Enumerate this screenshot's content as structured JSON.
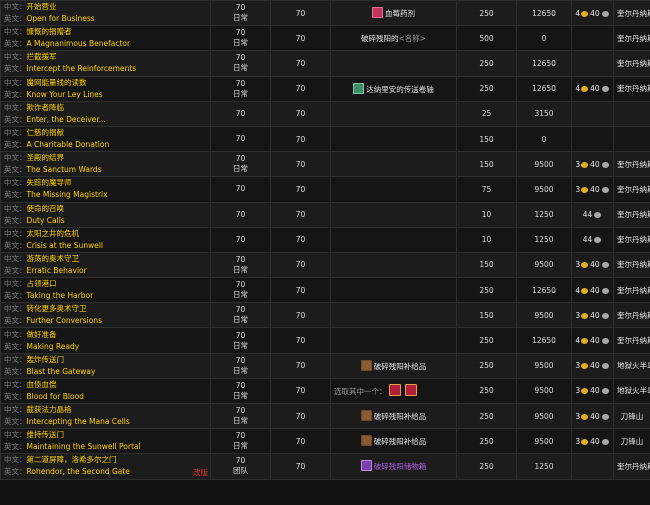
{
  "labels": {
    "zh": "中文：",
    "en": "英文："
  },
  "rows": [
    {
      "zh": "开始营业",
      "en": "Open for Business",
      "lvl": "70",
      "type": "日常",
      "req": "70",
      "reward": {
        "icon": "potion-icon",
        "tone": "red",
        "text": "血莓药剂"
      },
      "rep": "250",
      "xp": "12650",
      "gold": "4",
      "silver": "40",
      "zone": "奎尔丹纳斯岛"
    },
    {
      "zh": "慷慨的捐赠者",
      "en": "A Magnanimous Benefactor",
      "lvl": "70",
      "type": "日常",
      "req": "70",
      "reward": {
        "text": "破碎残阳的",
        "note": "<名称>"
      },
      "rep": "500",
      "xp": "0",
      "gold": "",
      "silver": "",
      "zone": "奎尔丹纳斯岛"
    },
    {
      "zh": "拦截援军",
      "en": "Intercept the Reinforcements",
      "lvl": "70",
      "type": "日常",
      "req": "70",
      "reward": {},
      "rep": "250",
      "xp": "12650",
      "gold": "",
      "silver": "",
      "zone": "奎尔丹纳斯岛"
    },
    {
      "zh": "魔网能量线的读数",
      "en": "Know Your Ley Lines",
      "lvl": "70",
      "type": "日常",
      "req": "70",
      "reward": {
        "icon": "scroll-icon",
        "tone": "teal",
        "text": "达纳里安的传送卷轴"
      },
      "rep": "250",
      "xp": "12650",
      "gold": "4",
      "silver": "40",
      "zone": "奎尔丹纳斯岛"
    },
    {
      "zh": "欺诈者降临",
      "en": "Enter, the Deceiver...",
      "lvl": "70",
      "type": "",
      "req": "70",
      "reward": {},
      "rep": "25",
      "xp": "3150",
      "gold": "",
      "silver": "",
      "zone": ""
    },
    {
      "zh": "仁慈的捐献",
      "en": "A Charitable Donation",
      "lvl": "70",
      "type": "",
      "req": "70",
      "reward": {},
      "rep": "150",
      "xp": "0",
      "gold": "",
      "silver": "",
      "zone": ""
    },
    {
      "zh": "圣殿的结界",
      "en": "The Sanctum Wards",
      "lvl": "70",
      "type": "日常",
      "req": "70",
      "reward": {},
      "rep": "150",
      "xp": "9500",
      "gold": "3",
      "silver": "40",
      "zone": "奎尔丹纳斯岛"
    },
    {
      "zh": "失踪的魔导师",
      "en": "The Missing Magistrix",
      "lvl": "70",
      "type": "",
      "req": "70",
      "reward": {},
      "rep": "75",
      "xp": "9500",
      "gold": "3",
      "silver": "40",
      "zone": "奎尔丹纳斯岛"
    },
    {
      "zh": "使命的召唤",
      "en": "Duty Calls",
      "lvl": "70",
      "type": "",
      "req": "70",
      "reward": {},
      "rep": "10",
      "xp": "1250",
      "gold": "",
      "silver": "44",
      "zone": "奎尔丹纳斯岛"
    },
    {
      "zh": "太阳之井的危机",
      "en": "Crisis at the Sunwell",
      "lvl": "70",
      "type": "",
      "req": "70",
      "reward": {},
      "rep": "10",
      "xp": "1250",
      "gold": "",
      "silver": "44",
      "zone": "奎尔丹纳斯岛"
    },
    {
      "zh": "游荡的奥术守卫",
      "en": "Erratic Behavior",
      "lvl": "70",
      "type": "日常",
      "req": "70",
      "reward": {},
      "rep": "150",
      "xp": "9500",
      "gold": "3",
      "silver": "40",
      "zone": "奎尔丹纳斯岛"
    },
    {
      "zh": "占领港口",
      "en": "Taking the Harbor",
      "lvl": "70",
      "type": "日常",
      "req": "70",
      "reward": {},
      "rep": "250",
      "xp": "12650",
      "gold": "4",
      "silver": "40",
      "zone": "奎尔丹纳斯岛"
    },
    {
      "zh": "转化更多奥术守卫",
      "en": "Further Conversions",
      "lvl": "70",
      "type": "日常",
      "req": "70",
      "reward": {},
      "rep": "150",
      "xp": "9500",
      "gold": "3",
      "silver": "40",
      "zone": "奎尔丹纳斯岛"
    },
    {
      "zh": "做好准备",
      "en": "Making Ready",
      "lvl": "70",
      "type": "日常",
      "req": "70",
      "reward": {},
      "rep": "250",
      "xp": "12650",
      "gold": "4",
      "silver": "40",
      "zone": "奎尔丹纳斯岛"
    },
    {
      "zh": "轰炸传送门",
      "en": "Blast the Gateway",
      "lvl": "70",
      "type": "日常",
      "req": "70",
      "reward": {
        "icon": "supply-bag-icon",
        "tone": "brown",
        "text": "破碎残阳补给品"
      },
      "rep": "250",
      "xp": "9500",
      "gold": "3",
      "silver": "40",
      "zone": "地狱火半岛"
    },
    {
      "zh": "血债血偿",
      "en": "Blood for Blood",
      "lvl": "70",
      "type": "日常",
      "req": "70",
      "reward": {
        "choose": "选取其中一个：",
        "options": 2
      },
      "rep": "250",
      "xp": "9500",
      "gold": "3",
      "silver": "40",
      "zone": "地狱火半岛"
    },
    {
      "zh": "截获法力晶格",
      "en": "Intercepting the Mana Cells",
      "lvl": "70",
      "type": "日常",
      "req": "70",
      "reward": {
        "icon": "supply-bag-icon",
        "tone": "brown",
        "text": "破碎残阳补给品"
      },
      "rep": "250",
      "xp": "9500",
      "gold": "3",
      "silver": "40",
      "zone": "刀锋山"
    },
    {
      "zh": "维持传送门",
      "en": "Maintaining the Sunwell Portal",
      "lvl": "70",
      "type": "日常",
      "req": "70",
      "reward": {
        "icon": "supply-bag-icon",
        "tone": "brown",
        "text": "破碎残阳补给品"
      },
      "rep": "250",
      "xp": "9500",
      "gold": "3",
      "silver": "40",
      "zone": "刀锋山"
    },
    {
      "zh": "第二道屏障，洛希多尔之门",
      "en": "Rohendor, the Second Gate",
      "flag": "改版",
      "lvl": "70",
      "type": "团队",
      "req": "70",
      "reward": {
        "icon": "supply-bag-icon",
        "tone": "purple",
        "text": "破碎残阳储物箱",
        "epic": true
      },
      "rep": "250",
      "xp": "1250",
      "gold": "",
      "silver": "",
      "zone": "奎尔丹纳斯岛"
    }
  ]
}
